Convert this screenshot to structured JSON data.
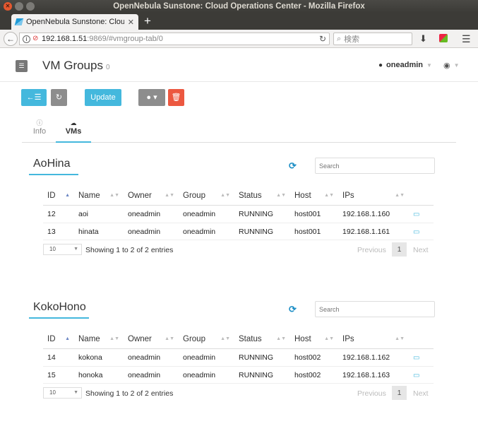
{
  "window": {
    "title": "OpenNebula Sunstone: Cloud Operations Center - Mozilla Firefox"
  },
  "browser": {
    "tab_title": "OpenNebula Sunstone: Cloud",
    "url_host": "192.168.1.51",
    "url_rest": ":9869/#vmgroup-tab/0",
    "search_placeholder": "検索"
  },
  "header": {
    "title": "VM Groups",
    "count": "0",
    "user": "oneadmin"
  },
  "toolbar": {
    "update_label": "Update"
  },
  "subtabs": [
    {
      "label": "Info",
      "icon": "info-icon"
    },
    {
      "label": "VMs",
      "icon": "cloud-icon"
    }
  ],
  "columns": [
    "ID",
    "Name",
    "Owner",
    "Group",
    "Status",
    "Host",
    "IPs"
  ],
  "groups": [
    {
      "name": "AoHina",
      "search_placeholder": "Search",
      "rows": [
        {
          "id": "12",
          "name": "aoi",
          "owner": "oneadmin",
          "group": "oneadmin",
          "status": "RUNNING",
          "host": "host001",
          "ip": "192.168.1.160"
        },
        {
          "id": "13",
          "name": "hinata",
          "owner": "oneadmin",
          "group": "oneadmin",
          "status": "RUNNING",
          "host": "host001",
          "ip": "192.168.1.161"
        }
      ],
      "page_length": "10",
      "info": "Showing 1 to 2 of 2 entries"
    },
    {
      "name": "KokoHono",
      "search_placeholder": "Search",
      "rows": [
        {
          "id": "14",
          "name": "kokona",
          "owner": "oneadmin",
          "group": "oneadmin",
          "status": "RUNNING",
          "host": "host002",
          "ip": "192.168.1.162"
        },
        {
          "id": "15",
          "name": "honoka",
          "owner": "oneadmin",
          "group": "oneadmin",
          "status": "RUNNING",
          "host": "host002",
          "ip": "192.168.1.163"
        }
      ],
      "page_length": "10",
      "info": "Showing 1 to 2 of 2 entries"
    }
  ],
  "pagination": {
    "previous": "Previous",
    "page": "1",
    "next": "Next"
  },
  "colors": {
    "accent": "#44b8dd",
    "danger": "#ec5840",
    "neutral": "#8d8d8d"
  }
}
